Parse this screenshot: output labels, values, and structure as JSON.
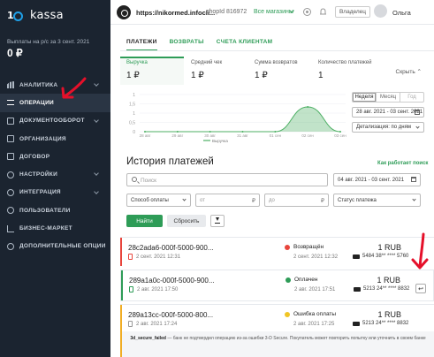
{
  "sidebar": {
    "logo_text": "kassa",
    "payout_label": "Выплаты на р/с за 3 сент. 2021",
    "payout_value": "0 ₽",
    "items": [
      {
        "label": "АНАЛИТИКА",
        "icon": "chart-bars-icon",
        "chevron": true
      },
      {
        "label": "ОПЕРАЦИИ",
        "icon": "operations-icon",
        "chevron": false,
        "active": true
      },
      {
        "label": "ДОКУМЕНТООБОРОТ",
        "icon": "documents-icon",
        "chevron": true
      },
      {
        "label": "ОРГАНИЗАЦИЯ",
        "icon": "organization-icon",
        "chevron": false
      },
      {
        "label": "ДОГОВОР",
        "icon": "contract-icon",
        "chevron": false
      },
      {
        "label": "НАСТРОЙКИ",
        "icon": "settings-icon",
        "chevron": true
      },
      {
        "label": "ИНТЕГРАЦИЯ",
        "icon": "integration-icon",
        "chevron": true
      },
      {
        "label": "ПОЛЬЗОВАТЕЛИ",
        "icon": "users-icon",
        "chevron": false
      },
      {
        "label": "БИЗНЕС-МАРКЕТ",
        "icon": "market-icon",
        "chevron": false
      },
      {
        "label": "ДОПОЛНИТЕЛЬНЫЕ ОПЦИИ",
        "icon": "options-icon",
        "chevron": false
      }
    ]
  },
  "topbar": {
    "shop_url": "https://nikormed.infocli...",
    "shop_id": "shopId 816972",
    "all_shops": "Все магазины",
    "owner": "Владелец",
    "user_name": "Ольга"
  },
  "tabs": [
    {
      "label": "ПЛАТЕЖИ",
      "active": true
    },
    {
      "label": "ВОЗВРАТЫ",
      "active": false
    },
    {
      "label": "СЧЕТА КЛИЕНТАМ",
      "active": false
    }
  ],
  "metrics": [
    {
      "label": "Выручка",
      "value": "1 ₽"
    },
    {
      "label": "Средний чек",
      "value": "1 ₽"
    },
    {
      "label": "Сумма возвратов",
      "value": "1 ₽"
    },
    {
      "label": "Количество платежей",
      "value": "1"
    }
  ],
  "hide_label": "Скрыть",
  "chart_data": {
    "type": "area",
    "categories": [
      "28 авг",
      "29 авг",
      "30 авг",
      "31 авг",
      "01 сен",
      "02 сен",
      "03 сен"
    ],
    "series": [
      {
        "name": "Выручка",
        "values": [
          0,
          0,
          0,
          0,
          0,
          1,
          0
        ]
      }
    ],
    "y_ticks": [
      "1",
      "1,5",
      "1",
      "0,5",
      "0"
    ],
    "ylim": [
      0,
      1.5
    ],
    "legend": "bottom",
    "color": "#4caf63"
  },
  "period": {
    "options": [
      "Неделя",
      "Месяц",
      "Год"
    ],
    "selected": "Неделя",
    "date_range": "28 авг. 2021 - 03 сент. 2021",
    "detail": "Детализация: по дням"
  },
  "history": {
    "title": "История платежей",
    "how_works": "Как работает поиск",
    "search_placeholder": "Поиск",
    "date_range": "04 авг. 2021 - 03 сент. 2021",
    "payment_method": "Способ оплаты",
    "from_placeholder": "от",
    "to_placeholder": "до",
    "currency": "₽",
    "status": "Статус платежа",
    "find": "Найти",
    "reset": "Сбросить"
  },
  "payments": [
    {
      "id": "28c2ada6-000f-5000-900...",
      "date": "2 сент. 2021 12:31",
      "status": "Возвращён",
      "status_date": "2 сент. 2021 12:32",
      "amount": "1 RUB",
      "card": "5484 38** **** 5760",
      "bar_color": "#e8453c",
      "dot_color": "#e8453c"
    },
    {
      "id": "289a1a0c-000f-5000-900...",
      "date": "2 авг. 2021 17:50",
      "status": "Оплачен",
      "status_date": "2 авг. 2021 17:51",
      "amount": "1 RUB",
      "card": "5213 24** **** 8832",
      "bar_color": "#2e9c57",
      "dot_color": "#2e9c57"
    },
    {
      "id": "289a13cc-000f-5000-800...",
      "date": "2 авг. 2021 17:24",
      "status": "Ошибка оплаты",
      "status_date": "2 авг. 2021 17:25",
      "amount": "1 RUB",
      "card": "5213 24** **** 8832",
      "bar_color": "#f0ad24",
      "dot_color": "#f0c524"
    }
  ],
  "error_note": {
    "code": "3d_secure_failed",
    "text": "— банк не подтвердил операцию из-за ошибки 3-D Secure. Покупатель может повторить попытку или уточнить в своем банке"
  }
}
